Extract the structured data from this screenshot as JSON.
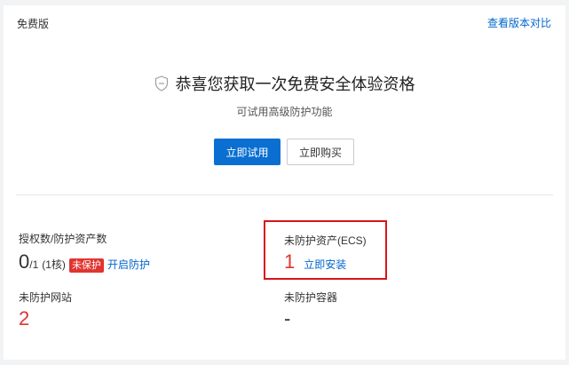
{
  "header": {
    "edition": "免费版",
    "compare_link": "查看版本对比"
  },
  "hero": {
    "title": "恭喜您获取一次免费安全体验资格",
    "subtitle": "可试用高级防护功能",
    "try_button": "立即试用",
    "buy_button": "立即购买",
    "icon": "shield-icon"
  },
  "stats": {
    "authorized": {
      "label": "授权数/防护资产数",
      "value": "0",
      "total": "/1",
      "cores": "(1核)",
      "badge": "未保护",
      "action": "开启防护"
    },
    "unprotected_ecs": {
      "label": "未防护资产(ECS)",
      "value": "1",
      "action": "立即安装"
    },
    "unprotected_sites": {
      "label": "未防护网站",
      "value": "2"
    },
    "unprotected_containers": {
      "label": "未防护容器",
      "value": "-"
    }
  },
  "colors": {
    "primary": "#0a6fd1",
    "danger": "#e0342f",
    "highlight_border": "#d8141b"
  }
}
